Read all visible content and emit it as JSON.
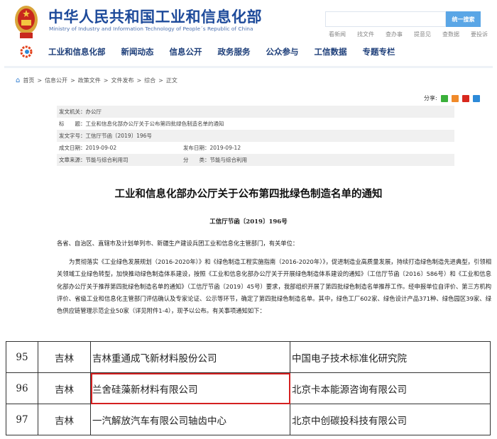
{
  "header": {
    "title": "中华人民共和国工业和信息化部",
    "subtitle": "Ministry of Industry and Information Technology of People´s Republic of China",
    "search_placeholder": "",
    "search_button": "统一搜索",
    "quick_links": [
      "看新闻",
      "找文件",
      "查办事",
      "提意见",
      "查数据",
      "要投诉"
    ]
  },
  "nav": [
    "工业和信息化部",
    "新闻动态",
    "信息公开",
    "政务服务",
    "公众参与",
    "工信数据",
    "专题专栏"
  ],
  "breadcrumb": [
    "首页",
    "信息公开",
    "政策文件",
    "文件发布",
    "综合",
    "正文"
  ],
  "share_label": "分享:",
  "meta": {
    "issuer": "发文机关：办公厅",
    "title": "标　　题：工业和信息化部办公厅关于公布第四批绿色制造名单的通知",
    "number": "发文字号：工信厅节函〔2019〕196号",
    "date_written": "成文日期：2019-09-02",
    "date_published": "发布日期：2019-09-12",
    "source": "文章来源：节能与综合利用司",
    "category": "分　　类：节能与综合利用"
  },
  "article": {
    "heading": "工业和信息化部办公厅关于公布第四批绿色制造名单的通知",
    "doc_number": "工信厅节函〔2019〕196号",
    "greeting": "各省、自治区、直辖市及计划单列市、新疆生产建设兵团工业和信息化主管部门，有关单位：",
    "paragraph": "为贯彻落实《工业绿色发展规划（2016-2020年）》和《绿色制造工程实施指南（2016-2020年）》，促进制造业高质量发展，持续打造绿色制造先进典型，引领相关领域工业绿色转型，加快推动绿色制造体系建设，按照《工业和信息化部办公厅关于开展绿色制造体系建设的通知》（工信厅节函〔2016〕586号）和《工业和信息化部办公厅关于推荐第四批绿色制造名单的通知》（工信厅节函〔2019〕45号）要求，我部组织开展了第四批绿色制造名单推荐工作。经申报单位自评价、第三方机构评价、省级工业和信息化主管部门评估确认及专家论证、公示等环节，确定了第四批绿色制造名单。其中，绿色工厂602家、绿色设计产品371种、绿色园区39家、绿色供应链管理示范企业50家（详见附件1-4），现予以公布。有关事项通知如下："
  },
  "table": [
    {
      "no": "95",
      "province": "吉林",
      "company": "吉林重通成飞新材料股份公司",
      "evaluator": "中国电子技术标准化研究院"
    },
    {
      "no": "96",
      "province": "吉林",
      "company": "兰舍硅藻新材料有限公司",
      "evaluator": "北京卡本能源咨询有限公司"
    },
    {
      "no": "97",
      "province": "吉林",
      "company": "一汽解放汽车有限公司轴齿中心",
      "evaluator": "北京中创碳投科技有限公司"
    }
  ]
}
